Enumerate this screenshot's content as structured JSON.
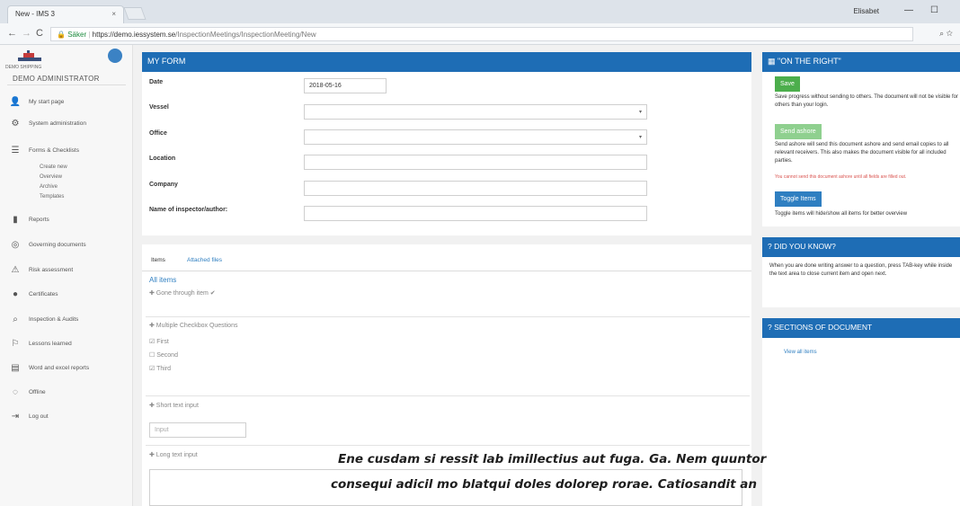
{
  "browser": {
    "tab_title": "New - IMS 3",
    "tab_close": "×",
    "user": "Elisabet",
    "minimize": "—",
    "maximize": "☐",
    "back": "←",
    "forward": "→",
    "reload": "C",
    "secure_label": "Säker",
    "url_host": "https://demo.iessystem.se",
    "url_path": "/InspectionMeetings/InspectionMeeting/New",
    "addr_icons": "⌕ ☆"
  },
  "sidebar": {
    "logo_text": "DEMO SHIPPING",
    "admin": "DEMO ADMINISTRATOR",
    "items": [
      {
        "label": "My start page",
        "icon": "👤"
      },
      {
        "label": "System administration",
        "icon": "⚙"
      },
      {
        "label": "Forms & Checklists",
        "icon": "☰"
      },
      {
        "label": "Reports",
        "icon": "▮"
      },
      {
        "label": "Governing documents",
        "icon": "◎"
      },
      {
        "label": "Risk assessment",
        "icon": "⚠"
      },
      {
        "label": "Certificates",
        "icon": "●"
      },
      {
        "label": "Inspection & Audits",
        "icon": "⌕"
      },
      {
        "label": "Lessons learned",
        "icon": "⚐"
      },
      {
        "label": "Word and excel reports",
        "icon": "▤"
      },
      {
        "label": "Offline",
        "icon": "◌"
      },
      {
        "label": "Log out",
        "icon": "⇥"
      }
    ],
    "sub_items": [
      "Create new",
      "Overview",
      "Archive",
      "Templates"
    ]
  },
  "form": {
    "title": "MY FORM",
    "date_label": "Date",
    "date_value": "2018-05-16",
    "vessel_label": "Vessel",
    "office_label": "Office",
    "location_label": "Location",
    "company_label": "Company",
    "inspector_label": "Name of inspector/author:",
    "select_arrow": "▾"
  },
  "items": {
    "tab_items": "Items",
    "tab_files": "Attached files",
    "all_items": "All items",
    "gone_through": "✚ Gone through item ✔",
    "multi_question": "✚ Multiple Checkbox Questions",
    "opt_first": "☑ First",
    "opt_second": "☐ Second",
    "opt_third": "☑ Third",
    "short_text": "✚ Short text input",
    "input_placeholder": "Input",
    "long_text": "✚ Long text input"
  },
  "right": {
    "on_right_title": "\"ON THE RIGHT\"",
    "save_label": "Save",
    "save_desc": "Save progress without sending to others. The document will not be visible for others than your login.",
    "send_label": "Send ashore",
    "send_desc": "Send ashore will send this document ashore and send email copies to all relevant receivers. This also makes the document visible for all included parties.",
    "send_warning": "You cannot send this document ashore until all fields are filled out.",
    "toggle_label": "Toggle Items",
    "toggle_desc": "Toggle items will hide/show all items for better overview",
    "did_you_know_title": "? DID YOU KNOW?",
    "did_you_know_text": "When you are done writing answer to a question, press TAB-key while inside the text area to close current item and open next.",
    "sections_title": "? SECTIONS OF DOCUMENT",
    "view_all": "View all items"
  },
  "overlay": {
    "line1": "Ene cusdam si ressit lab imillectius aut fuga. Ga. Nem quuntor",
    "line2": "consequi adicil mo blatqui doles dolorep rorae. Catiosandit an"
  },
  "colors": {
    "primary_blue": "#1e6db5",
    "save_green": "#4cae4c",
    "send_green": "#8fd08f",
    "toggle_blue": "#2f7fc1"
  }
}
